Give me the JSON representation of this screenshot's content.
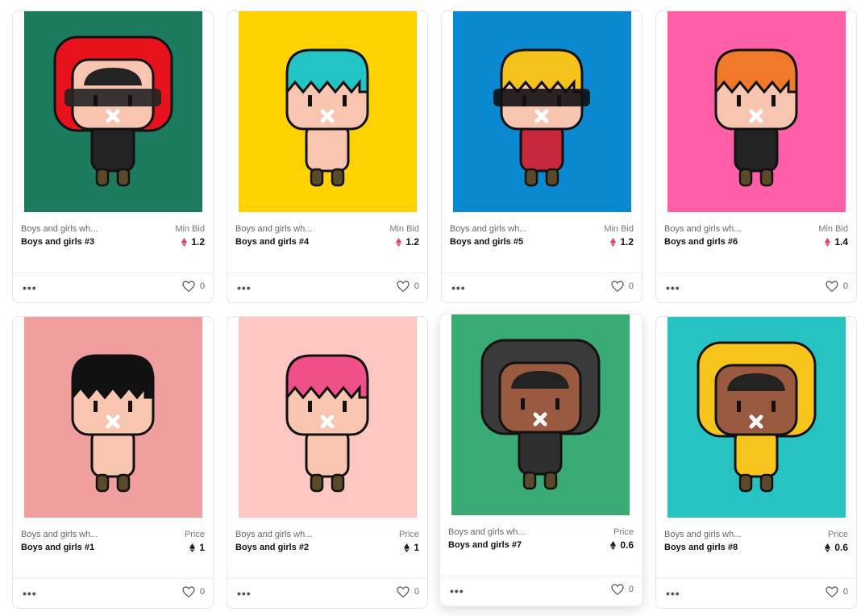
{
  "colors": {
    "eth_pink": "#e73c7e",
    "eth_black": "#222222"
  },
  "cards": [
    {
      "collection": "Boys and girls wh...",
      "name": "Boys and girls #3",
      "price_label": "Min Bid",
      "price": "1.2",
      "currency_icon": "eth-pink",
      "likes": "0",
      "menu": "•••",
      "bg": "#1c7a5e"
    },
    {
      "collection": "Boys and girls wh...",
      "name": "Boys and girls #4",
      "price_label": "Min Bid",
      "price": "1.2",
      "currency_icon": "eth-pink",
      "likes": "0",
      "menu": "•••",
      "bg": "#ffd200"
    },
    {
      "collection": "Boys and girls wh...",
      "name": "Boys and girls #5",
      "price_label": "Min Bid",
      "price": "1.2",
      "currency_icon": "eth-pink",
      "likes": "0",
      "menu": "•••",
      "bg": "#0a88d0"
    },
    {
      "collection": "Boys and girls wh...",
      "name": "Boys and girls #6",
      "price_label": "Min Bid",
      "price": "1.4",
      "currency_icon": "eth-pink",
      "likes": "0",
      "menu": "•••",
      "bg": "#ff5fa8"
    },
    {
      "collection": "Boys and girls wh...",
      "name": "Boys and girls #1",
      "price_label": "Price",
      "price": "1",
      "currency_icon": "eth-black",
      "likes": "0",
      "menu": "•••",
      "bg": "#f19e9e"
    },
    {
      "collection": "Boys and girls wh...",
      "name": "Boys and girls #2",
      "price_label": "Price",
      "price": "1",
      "currency_icon": "eth-black",
      "likes": "0",
      "menu": "•••",
      "bg": "#ffc7c2"
    },
    {
      "collection": "Boys and girls wh...",
      "name": "Boys and girls #7",
      "price_label": "Price",
      "price": "0.6",
      "currency_icon": "eth-black",
      "likes": "0",
      "menu": "•••",
      "bg": "#3aab74"
    },
    {
      "collection": "Boys and girls wh...",
      "name": "Boys and girls #8",
      "price_label": "Price",
      "price": "0.6",
      "currency_icon": "eth-black",
      "likes": "0",
      "menu": "•••",
      "bg": "#26c3c2"
    }
  ]
}
